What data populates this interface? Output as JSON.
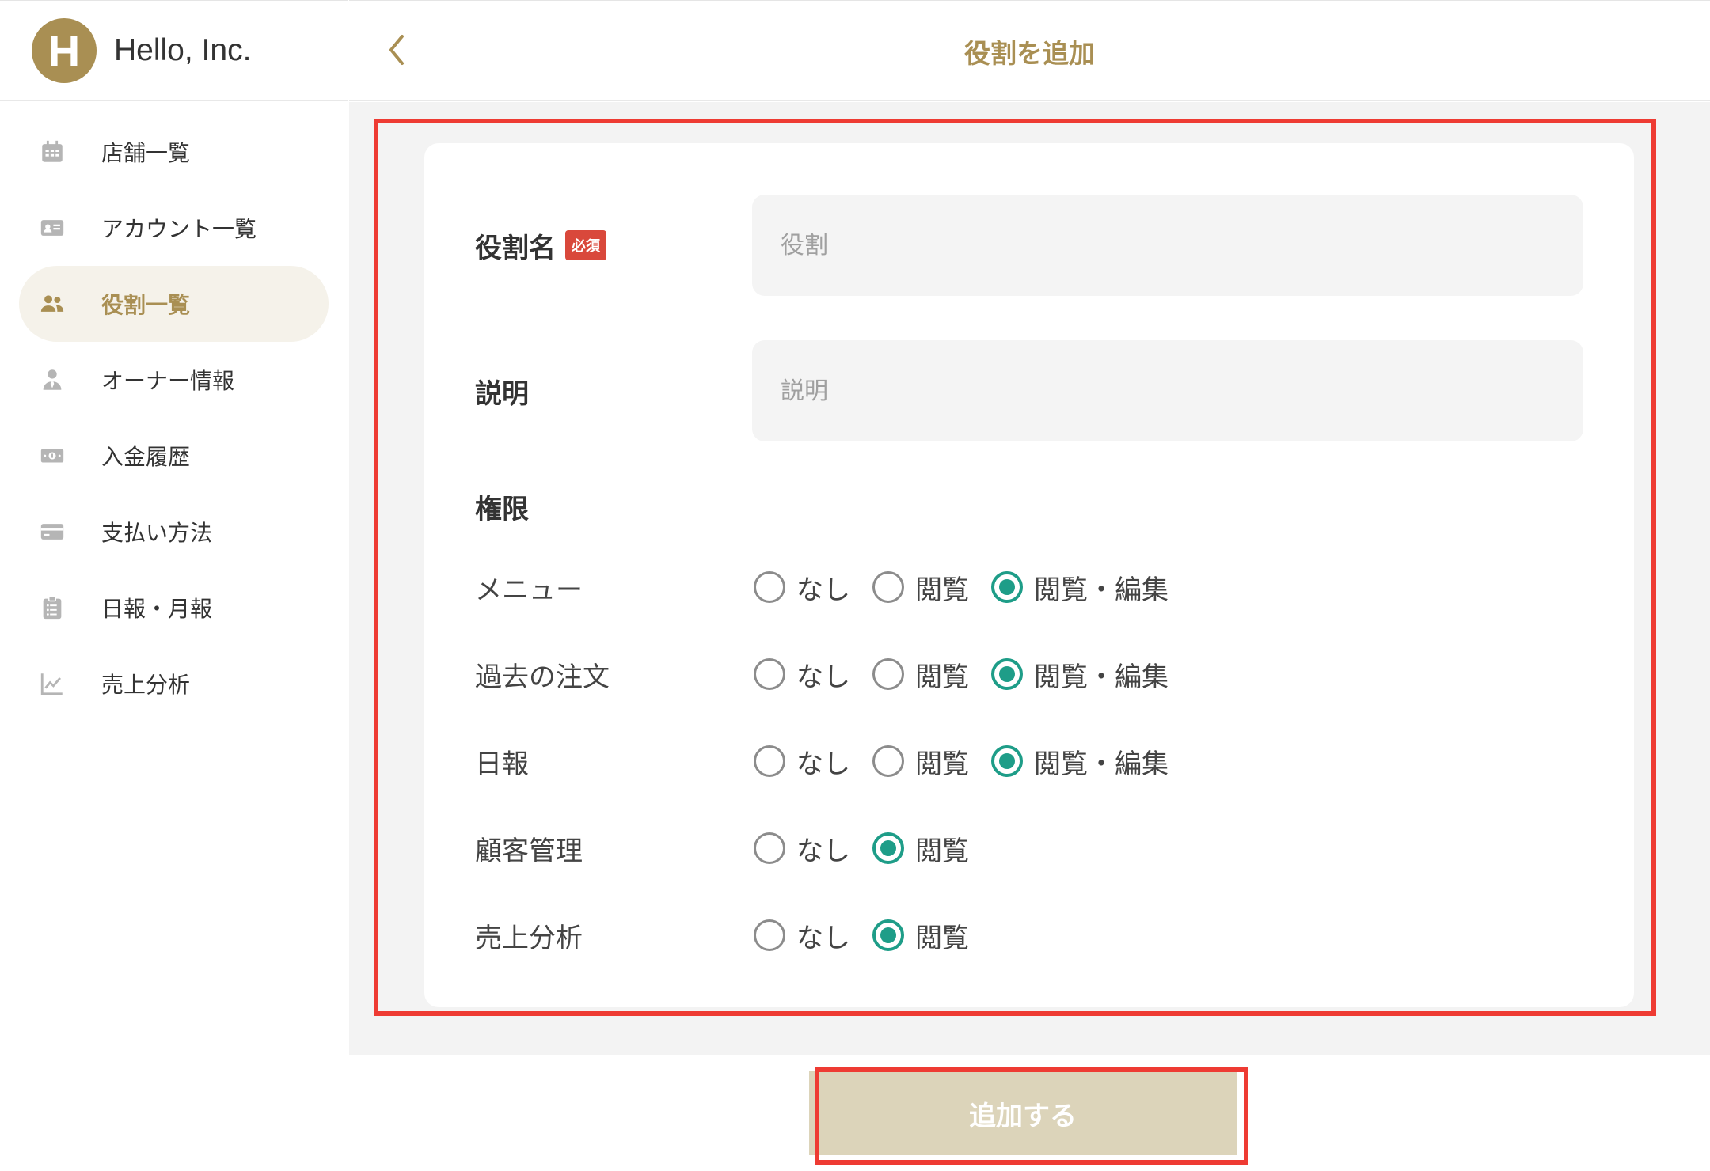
{
  "brand": {
    "logo_letter": "H",
    "name": "Hello, Inc."
  },
  "sidebar": {
    "items": [
      {
        "label": "店舗一覧",
        "icon": "calendar-icon"
      },
      {
        "label": "アカウント一覧",
        "icon": "id-card-icon"
      },
      {
        "label": "役割一覧",
        "icon": "users-icon",
        "active": true
      },
      {
        "label": "オーナー情報",
        "icon": "user-tie-icon"
      },
      {
        "label": "入金履歴",
        "icon": "money-bill-icon"
      },
      {
        "label": "支払い方法",
        "icon": "credit-card-icon"
      },
      {
        "label": "日報・月報",
        "icon": "clipboard-list-icon"
      },
      {
        "label": "売上分析",
        "icon": "line-chart-icon"
      }
    ]
  },
  "header": {
    "title": "役割を追加",
    "back_icon": "chevron-left-icon"
  },
  "form": {
    "role_name": {
      "label": "役割名",
      "required_badge": "必須",
      "placeholder": "役割",
      "value": ""
    },
    "description": {
      "label": "説明",
      "placeholder": "説明",
      "value": ""
    },
    "permissions_heading": "権限",
    "permissions": [
      {
        "name": "メニュー",
        "options": [
          "なし",
          "閲覧",
          "閲覧・編集"
        ],
        "selected": 2
      },
      {
        "name": "過去の注文",
        "options": [
          "なし",
          "閲覧",
          "閲覧・編集"
        ],
        "selected": 2
      },
      {
        "name": "日報",
        "options": [
          "なし",
          "閲覧",
          "閲覧・編集"
        ],
        "selected": 2
      },
      {
        "name": "顧客管理",
        "options": [
          "なし",
          "閲覧"
        ],
        "selected": 1
      },
      {
        "name": "売上分析",
        "options": [
          "なし",
          "閲覧"
        ],
        "selected": 1
      }
    ]
  },
  "submit": {
    "label": "追加する"
  },
  "colors": {
    "accent": "#a98f53",
    "radio_checked": "#1e9d88",
    "required_badge": "#d9483b",
    "submit_disabled": "#dcd4ba",
    "highlight": "#ee3b33"
  }
}
